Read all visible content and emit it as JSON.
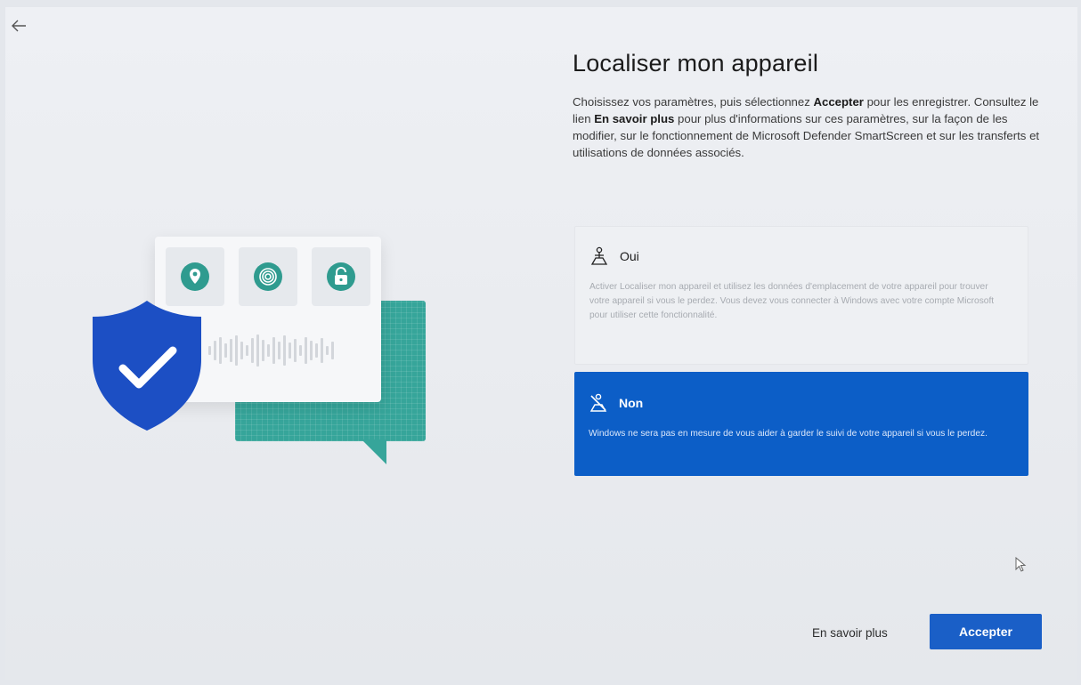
{
  "page": {
    "title": "Localiser mon appareil",
    "description": {
      "part1": "Choisissez vos paramètres, puis sélectionnez ",
      "accept_bold": "Accepter",
      "part2": " pour les enregistrer. Consultez le lien ",
      "learn_more_bold": "En savoir plus",
      "part3": " pour plus d'informations sur ces paramètres, sur la façon de les modifier, sur le fonctionnement de Microsoft Defender SmartScreen et sur les transferts et utilisations de données associés."
    }
  },
  "options": [
    {
      "label": "Oui",
      "icon": "location-person-icon",
      "text": "Activer Localiser mon appareil et utilisez les données d'emplacement de votre appareil pour trouver votre appareil si vous le perdez. Vous devez vous connecter à Windows avec votre compte Microsoft pour utiliser cette fonctionnalité.",
      "selected": false
    },
    {
      "label": "Non",
      "icon": "location-off-icon",
      "text": "Windows ne sera pas en mesure de vous aider à garder le suivi de votre appareil si vous le perdez.",
      "selected": true
    }
  ],
  "footer": {
    "learn_more": "En savoir plus",
    "accept": "Accepter"
  },
  "colors": {
    "accent": "#1a5fc7",
    "selected_option": "#0c5ec7",
    "teal": "#36a59a",
    "shield": "#1c4fc4"
  }
}
